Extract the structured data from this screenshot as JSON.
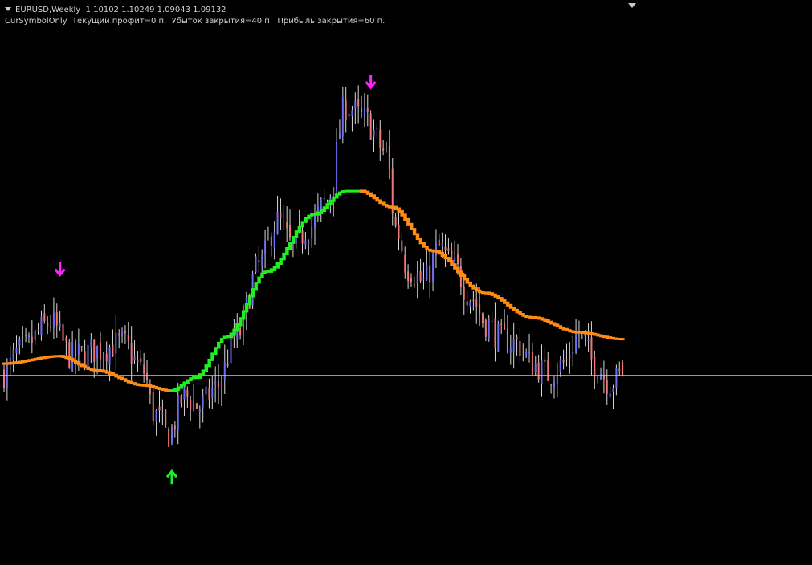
{
  "header": {
    "symbol_timeframe": "EURUSD,Weekly",
    "ohlc": "1.10102 1.10249 1.09043 1.09132",
    "indicator_line": "CurSymbolOnly  Текущий профит=0 п.  Убыток закрытия=40 п.  Прибыль закрытия=60 п."
  },
  "colors": {
    "background": "#000000",
    "bull_candle": "#6e6ef0",
    "bear_candle": "#f07878",
    "wick": "#d8d8d8",
    "ma_rising": "#22ee22",
    "ma_falling": "#ff8c14",
    "sell_arrow": "#ff22ff",
    "buy_arrow": "#22ee22",
    "price_line": "#c8c8c8"
  },
  "chart_data": {
    "type": "candlestick",
    "symbol": "EURUSD",
    "timeframe": "Weekly",
    "ohlc_last": {
      "open": 1.10102,
      "high": 1.10249,
      "low": 1.09043,
      "close": 1.09132
    },
    "price_line": 1.09132,
    "x_count": 200,
    "ylim": [
      0.96,
      1.35
    ],
    "close_anchors": [
      [
        0,
        1.093
      ],
      [
        5,
        1.109
      ],
      [
        15,
        1.13
      ],
      [
        22,
        1.105
      ],
      [
        30,
        1.11
      ],
      [
        38,
        1.115
      ],
      [
        45,
        1.094
      ],
      [
        48,
        1.064
      ],
      [
        53,
        1.048
      ],
      [
        58,
        1.076
      ],
      [
        63,
        1.068
      ],
      [
        68,
        1.082
      ],
      [
        75,
        1.12
      ],
      [
        82,
        1.172
      ],
      [
        88,
        1.205
      ],
      [
        93,
        1.186
      ],
      [
        98,
        1.2
      ],
      [
        104,
        1.22
      ],
      [
        110,
        1.29
      ],
      [
        116,
        1.28
      ],
      [
        123,
        1.255
      ],
      [
        126,
        1.2
      ],
      [
        130,
        1.17
      ],
      [
        135,
        1.16
      ],
      [
        140,
        1.185
      ],
      [
        145,
        1.17
      ],
      [
        150,
        1.15
      ],
      [
        155,
        1.13
      ],
      [
        160,
        1.118
      ],
      [
        165,
        1.115
      ],
      [
        170,
        1.1
      ],
      [
        175,
        1.092
      ],
      [
        180,
        1.1
      ],
      [
        185,
        1.122
      ],
      [
        190,
        1.1
      ],
      [
        195,
        1.086
      ],
      [
        199,
        1.0913
      ]
    ],
    "ma_anchors": [
      [
        0,
        1.1
      ],
      [
        18,
        1.1055
      ],
      [
        30,
        1.095
      ],
      [
        45,
        1.084
      ],
      [
        54,
        1.08
      ],
      [
        62,
        1.09
      ],
      [
        72,
        1.12
      ],
      [
        85,
        1.168
      ],
      [
        100,
        1.21
      ],
      [
        110,
        1.227
      ],
      [
        115,
        1.227
      ],
      [
        125,
        1.215
      ],
      [
        138,
        1.183
      ],
      [
        155,
        1.152
      ],
      [
        170,
        1.134
      ],
      [
        185,
        1.123
      ],
      [
        199,
        1.118
      ]
    ],
    "ma_turns": {
      "rising_from": 54,
      "rising_to": 114
    },
    "arrows": [
      {
        "type": "sell",
        "index": 18,
        "price": 1.17
      },
      {
        "type": "buy",
        "index": 54,
        "price": 1.016
      },
      {
        "type": "sell",
        "index": 118,
        "price": 1.308
      }
    ]
  }
}
